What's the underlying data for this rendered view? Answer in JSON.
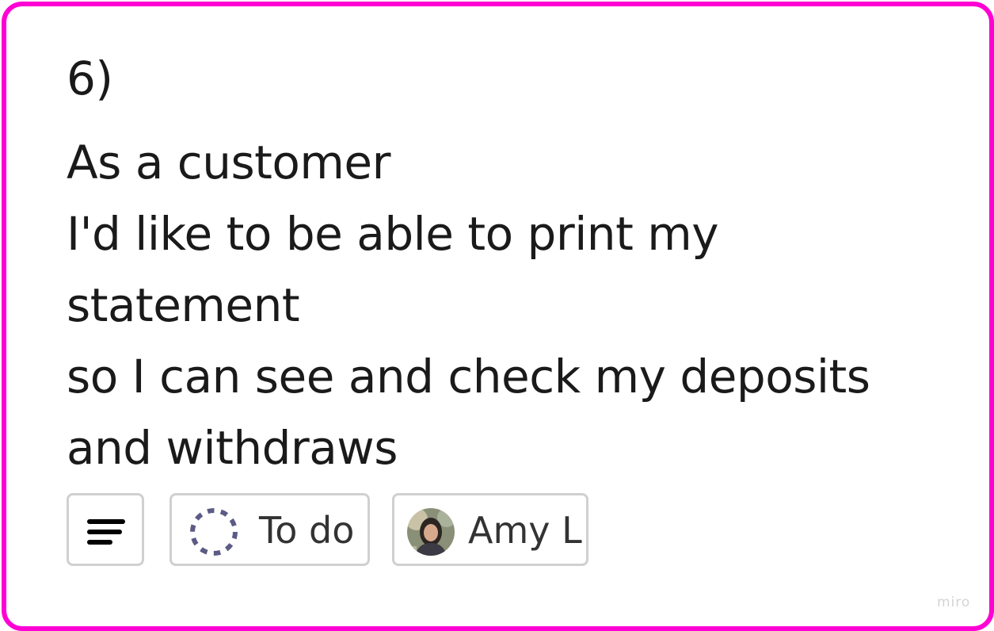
{
  "card": {
    "border_color": "#ff00d4",
    "lines": [
      "6)",
      "As a customer",
      "I'd like to be able to print my",
      "statement",
      "so I can see and check my deposits",
      "and withdraws"
    ]
  },
  "chips": {
    "description_icon": "text-lines-icon",
    "status": {
      "icon": "dashed-circle-icon",
      "label": "To do"
    },
    "assignee": {
      "avatar": "user-avatar",
      "label": "Amy L"
    }
  },
  "watermark": "miro"
}
